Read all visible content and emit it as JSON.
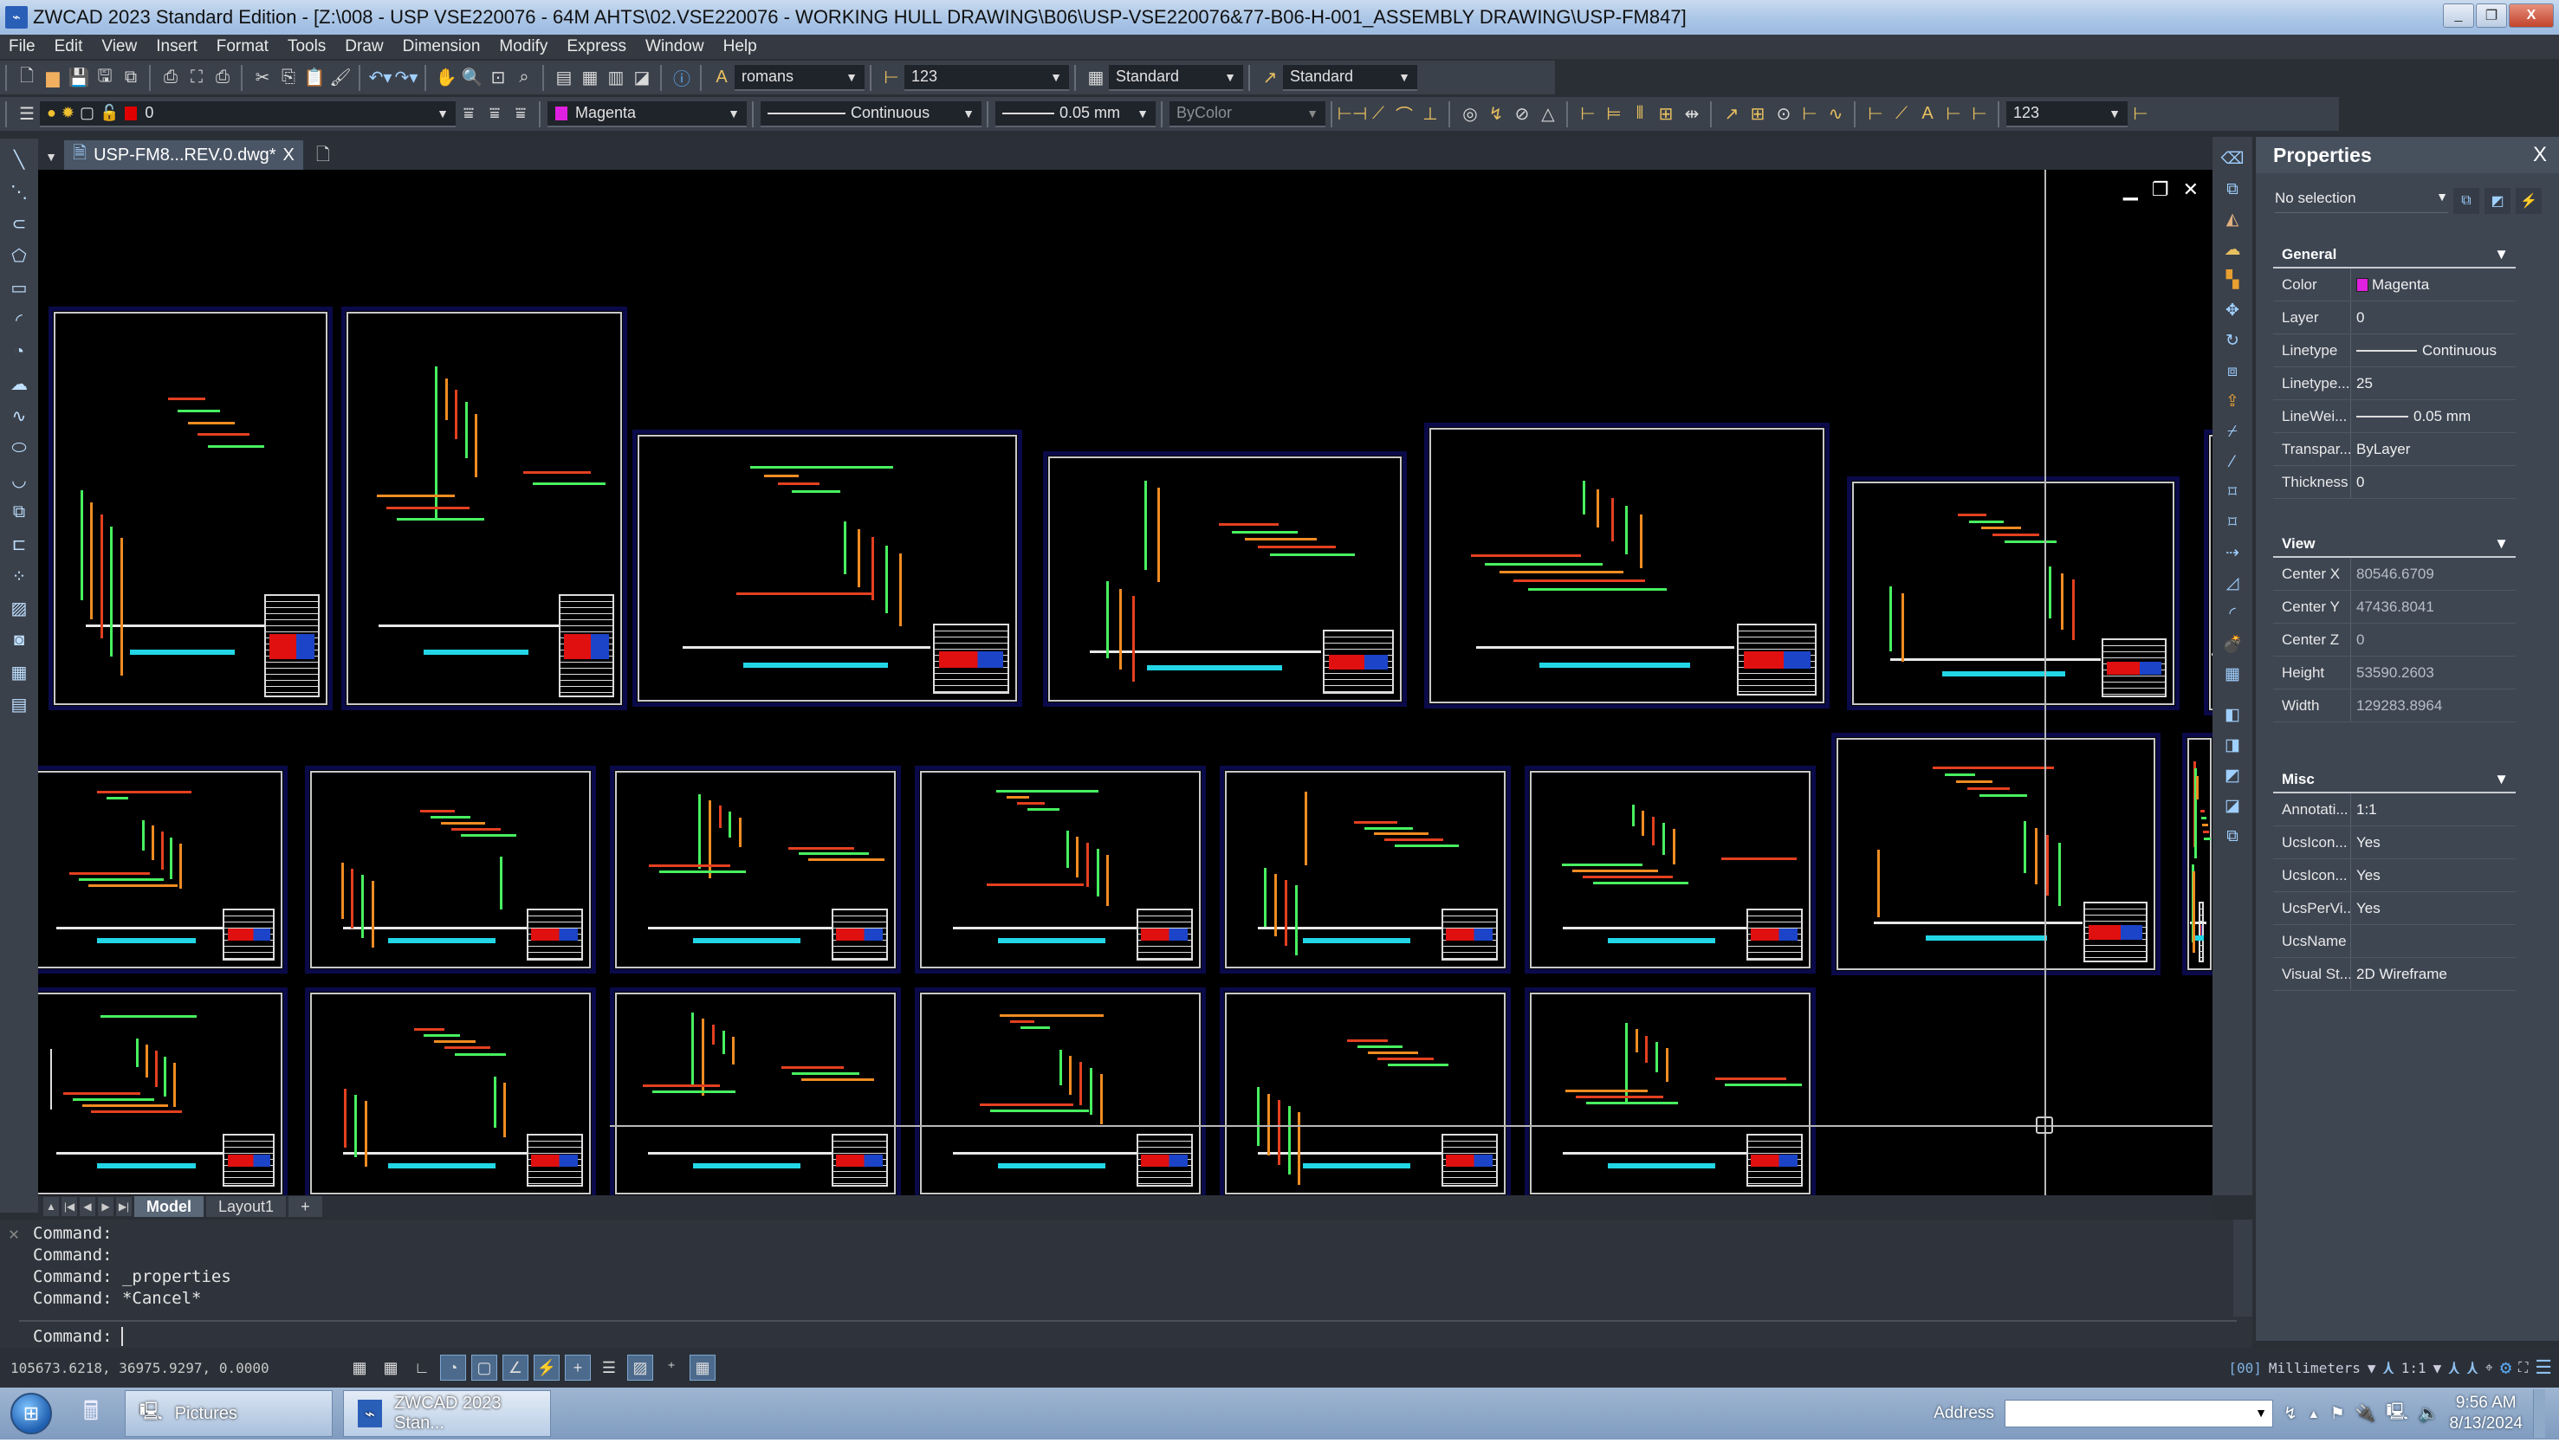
{
  "window": {
    "title": "ZWCAD 2023 Standard Edition - [Z:\\008 - USP VSE220076 - 64M AHTS\\02.VSE220076 - WORKING HULL DRAWING\\B06\\USP-VSE220076&77-B06-H-001_ASSEMBLY DRAWING\\USP-FM847]",
    "minimize": "_",
    "restore": "❐",
    "close": "X"
  },
  "menu": [
    "File",
    "Edit",
    "View",
    "Insert",
    "Format",
    "Tools",
    "Draw",
    "Dimension",
    "Modify",
    "Express",
    "Window",
    "Help"
  ],
  "toolbar1": {
    "icons": [
      "new-icon",
      "open-icon",
      "save-icon",
      "save-as-icon",
      "batch-save-icon",
      "print-icon",
      "print-preview-icon",
      "plot-icon",
      "cut-icon",
      "copy-icon",
      "paste-icon",
      "match-properties-icon",
      "undo-icon",
      "redo-icon",
      "pan-icon",
      "zoom-realtime-icon",
      "zoom-window-icon",
      "zoom-previous-icon",
      "properties-icon",
      "design-center-icon",
      "tool-palettes-icon",
      "sheet-set-icon",
      "help-icon"
    ],
    "text_style": "romans",
    "dim_style": "123",
    "table_style": "Standard",
    "multileader_style": "Standard"
  },
  "toolbar2": {
    "layer": "0",
    "layer_color": "#e00000",
    "color": "Magenta",
    "color_swatch": "#e020e0",
    "linetype": "Continuous",
    "lineweight": "0.05 mm",
    "plotstyle": "ByColor",
    "dim_style2": "123"
  },
  "doc_tab": {
    "label": "USP-FM8...REV.0.dwg*",
    "close": "X"
  },
  "layout_tabs": [
    {
      "label": "Model",
      "active": true
    },
    {
      "label": "Layout1",
      "active": false
    },
    {
      "label": "+",
      "active": false
    }
  ],
  "properties": {
    "title": "Properties",
    "close": "X",
    "selection": "No selection",
    "groups": [
      {
        "name": "General",
        "rows": [
          {
            "key": "Color",
            "value": "Magenta",
            "swatch": "#e020e0"
          },
          {
            "key": "Layer",
            "value": "0"
          },
          {
            "key": "Linetype",
            "value": "Continuous",
            "line": true
          },
          {
            "key": "Linetype...",
            "value": "25"
          },
          {
            "key": "LineWei...",
            "value": "0.05 mm",
            "line": true
          },
          {
            "key": "Transpar...",
            "value": "ByLayer"
          },
          {
            "key": "Thickness",
            "value": "0"
          }
        ]
      },
      {
        "name": "View",
        "rows": [
          {
            "key": "Center X",
            "value": "80546.6709",
            "dim": true
          },
          {
            "key": "Center Y",
            "value": "47436.8041",
            "dim": true
          },
          {
            "key": "Center Z",
            "value": "0",
            "dim": true
          },
          {
            "key": "Height",
            "value": "53590.2603",
            "dim": true
          },
          {
            "key": "Width",
            "value": "129283.8964",
            "dim": true
          }
        ]
      },
      {
        "name": "Misc",
        "rows": [
          {
            "key": "Annotati...",
            "value": "1:1"
          },
          {
            "key": "UcsIcon...",
            "value": "Yes"
          },
          {
            "key": "UcsIcon...",
            "value": "Yes"
          },
          {
            "key": "UcsPerVi...",
            "value": "Yes"
          },
          {
            "key": "UcsName",
            "value": ""
          },
          {
            "key": "Visual St...",
            "value": "2D Wireframe"
          }
        ]
      }
    ]
  },
  "command": {
    "history": [
      "Command:",
      "Command:",
      "Command: _properties",
      "Command: *Cancel*"
    ],
    "prompt": "Command:"
  },
  "status": {
    "coords": "105673.6218, 36975.9297, 0.0000",
    "units": "Millimeters",
    "annotation_scale": "1:1"
  },
  "taskbar": {
    "tasks": [
      "Pictures",
      "ZWCAD 2023 Stan..."
    ],
    "address_label": "Address",
    "time": "9:56 AM",
    "date": "8/13/2024"
  }
}
